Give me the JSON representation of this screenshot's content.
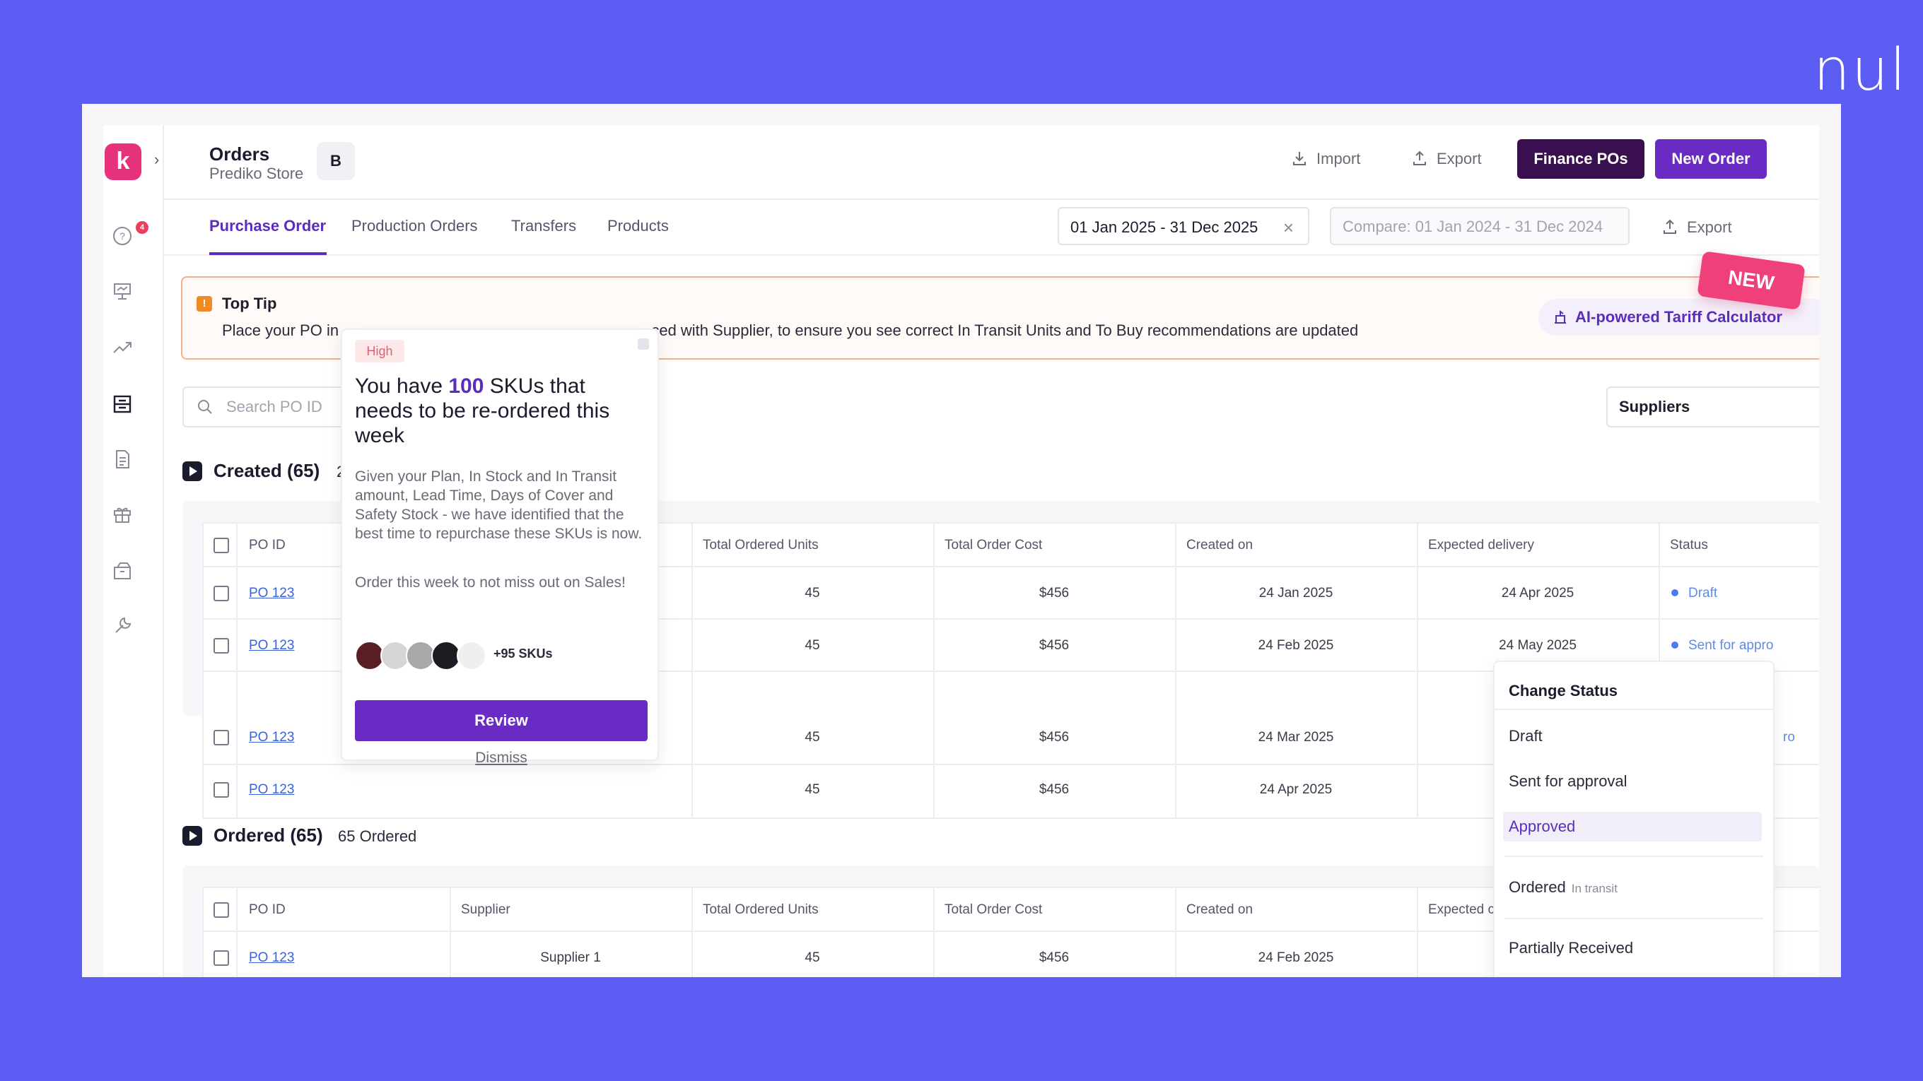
{
  "brand": "nul",
  "header": {
    "title": "Orders",
    "subtitle": "Prediko Store",
    "store_badge": "B",
    "import_label": "Import",
    "export_label": "Export",
    "finance_label": "Finance  POs",
    "new_order_label": "New Order"
  },
  "sidebar": {
    "logo": "k",
    "notification_count": "4"
  },
  "tabs": [
    "Purchase Order",
    "Production Orders",
    "Transfers",
    "Products"
  ],
  "date_range": "01 Jan 2025 - 31 Dec 2025",
  "compare_range": "Compare: 01 Jan 2024 - 31 Dec 2024",
  "export2_label": "Export",
  "tip": {
    "title": "Top Tip",
    "body_start": "Place your PO in",
    "body_end": "ced with Supplier, to ensure you see correct In Transit Units and To Buy recommendations are updated",
    "ai_button": "AI-powered Tariff Calculator",
    "new_badge": "NEW"
  },
  "search": {
    "placeholder": "Search PO ID"
  },
  "suppliers_filter": "Suppliers",
  "popover": {
    "priority": "High",
    "title_pre": "You have ",
    "title_num": "100",
    "title_post": " SKUs that needs to be re-ordered this week",
    "description": "Given your Plan, In Stock and In Transit amount, Lead Time, Days of Cover and Safety Stock - we have identified that the best time to repurchase these SKUs is now.",
    "note": "Order this week to not miss out on Sales!",
    "more_skus": "+95 SKUs",
    "review_label": "Review",
    "dismiss_label": "Dismiss"
  },
  "created": {
    "title": "Created (65)",
    "count_fragment": "2",
    "columns": [
      "PO ID",
      "Total Ordered Units",
      "Total Order Cost",
      "Created on",
      "Expected delivery",
      "Status"
    ],
    "rows": [
      {
        "po": "PO 123",
        "units": "45",
        "cost": "$456",
        "created": "24 Jan 2025",
        "expected": "24 Apr 2025",
        "status": "Draft"
      },
      {
        "po": "PO 123",
        "units": "45",
        "cost": "$456",
        "created": "24 Feb 2025",
        "expected": "24 May 2025",
        "status": "Sent for appro"
      },
      {
        "po": "PO 123",
        "units": "45",
        "cost": "$456",
        "created": "24 Mar 2025",
        "expected": "",
        "status": "ro"
      },
      {
        "po": "PO 123",
        "units": "45",
        "cost": "$456",
        "created": "24 Apr 2025",
        "expected": "",
        "status": ""
      }
    ]
  },
  "ordered": {
    "title": "Ordered (65)",
    "count_text": "65 Ordered",
    "columns": [
      "PO ID",
      "Supplier",
      "Total Ordered Units",
      "Total Order Cost",
      "Created on",
      "Expected c"
    ],
    "rows": [
      {
        "po": "PO 123",
        "supplier": "Supplier 1",
        "units": "45",
        "cost": "$456",
        "created": "24 Feb 2025"
      }
    ]
  },
  "status_menu": {
    "title": "Change Status",
    "items": [
      "Draft",
      "Sent for approval",
      "Approved",
      "Ordered",
      "Partially Received"
    ],
    "ordered_sub": "In transit"
  },
  "colors": {
    "background": "#5a5cf2",
    "accent": "#6a2bc4",
    "finance": "#3a0f4f",
    "logo": "#e6317b"
  }
}
